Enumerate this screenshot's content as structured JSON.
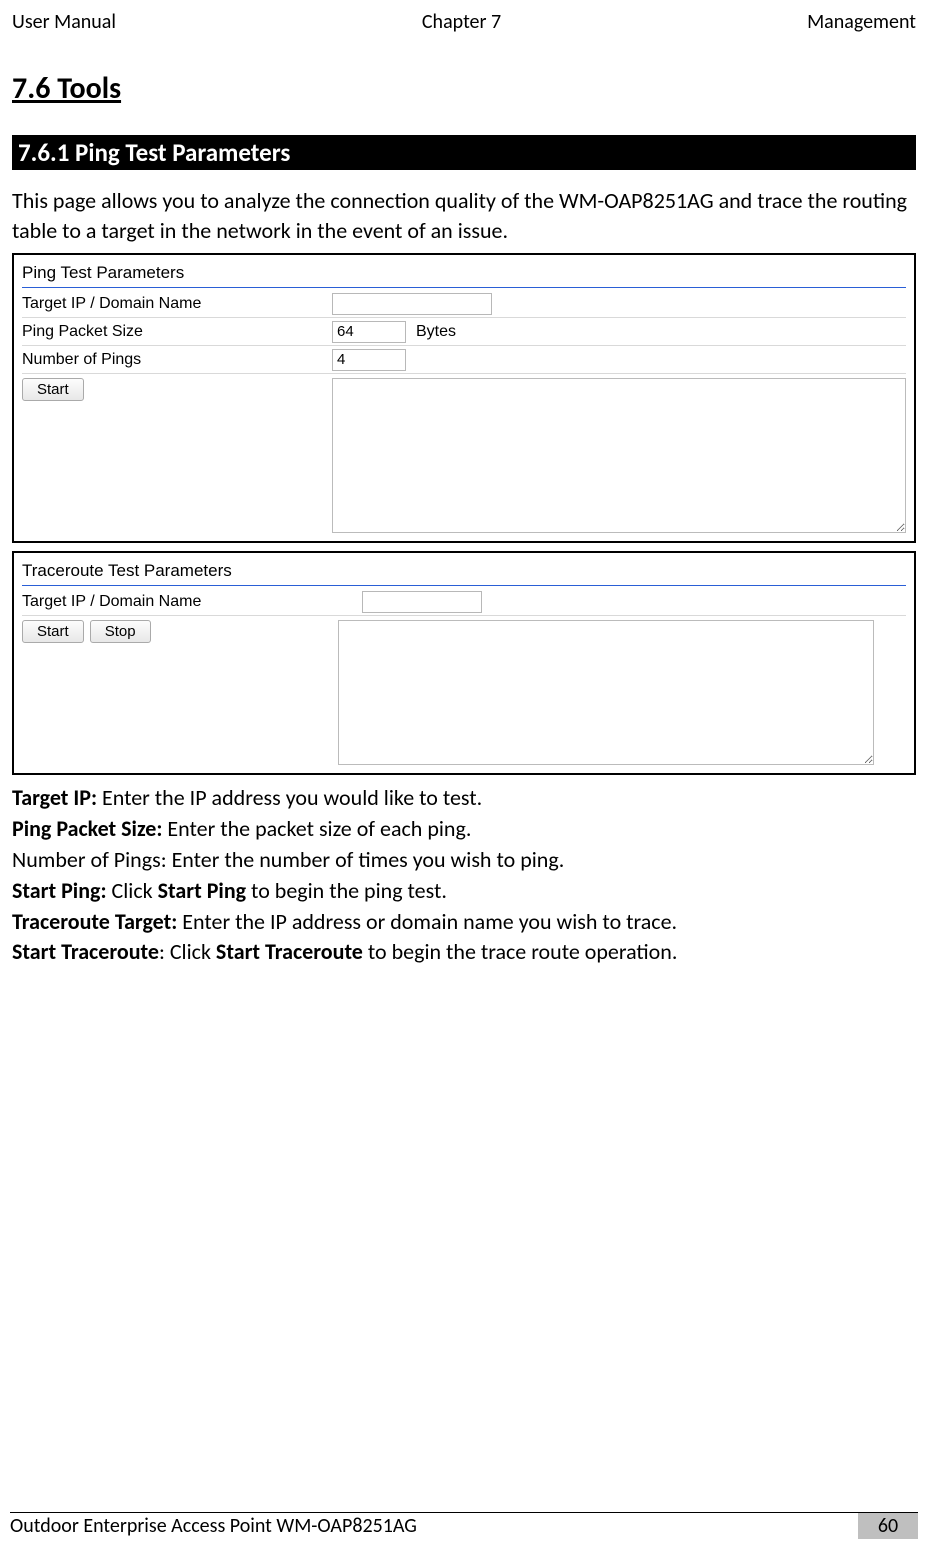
{
  "header": {
    "left": "User Manual",
    "center": "Chapter 7",
    "right": "Management"
  },
  "section": {
    "title": "7.6 Tools",
    "subtitle": "7.6.1 Ping Test Parameters",
    "intro": "This page allows you to analyze the connection quality of the WM-OAP8251AG and trace the routing table to a target in the network in the event of an issue."
  },
  "ping_panel": {
    "title": "Ping Test Parameters",
    "target_label": "Target IP / Domain Name",
    "target_value": "",
    "size_label": "Ping Packet Size",
    "size_value": "64",
    "size_unit": "Bytes",
    "count_label": "Number of Pings",
    "count_value": "4",
    "start_label": "Start",
    "output": ""
  },
  "trace_panel": {
    "title": "Traceroute Test Parameters",
    "target_label": "Target IP / Domain Name",
    "target_value": "",
    "start_label": "Start",
    "stop_label": "Stop",
    "output": ""
  },
  "defs": {
    "l1b": "Target IP:",
    "l1t": " Enter the IP address you would like to test.",
    "l2b": "Ping Packet Size:",
    "l2t": " Enter the packet size of each ping.",
    "l3": "Number of Pings: Enter the number of times you wish to ping.",
    "l4b": "Start Ping:",
    "l4t1": " Click ",
    "l4t2": "Start Ping",
    "l4t3": " to begin the ping test.",
    "l5b": "Traceroute Target:",
    "l5t": " Enter the IP address or domain name you wish to trace.",
    "l6b1": "Start Traceroute",
    "l6t1": ": Click ",
    "l6b2": "Start Traceroute",
    "l6t2": " to begin the trace route operation."
  },
  "footer": {
    "left": "Outdoor Enterprise Access Point WM-OAP8251AG",
    "page": "60"
  }
}
